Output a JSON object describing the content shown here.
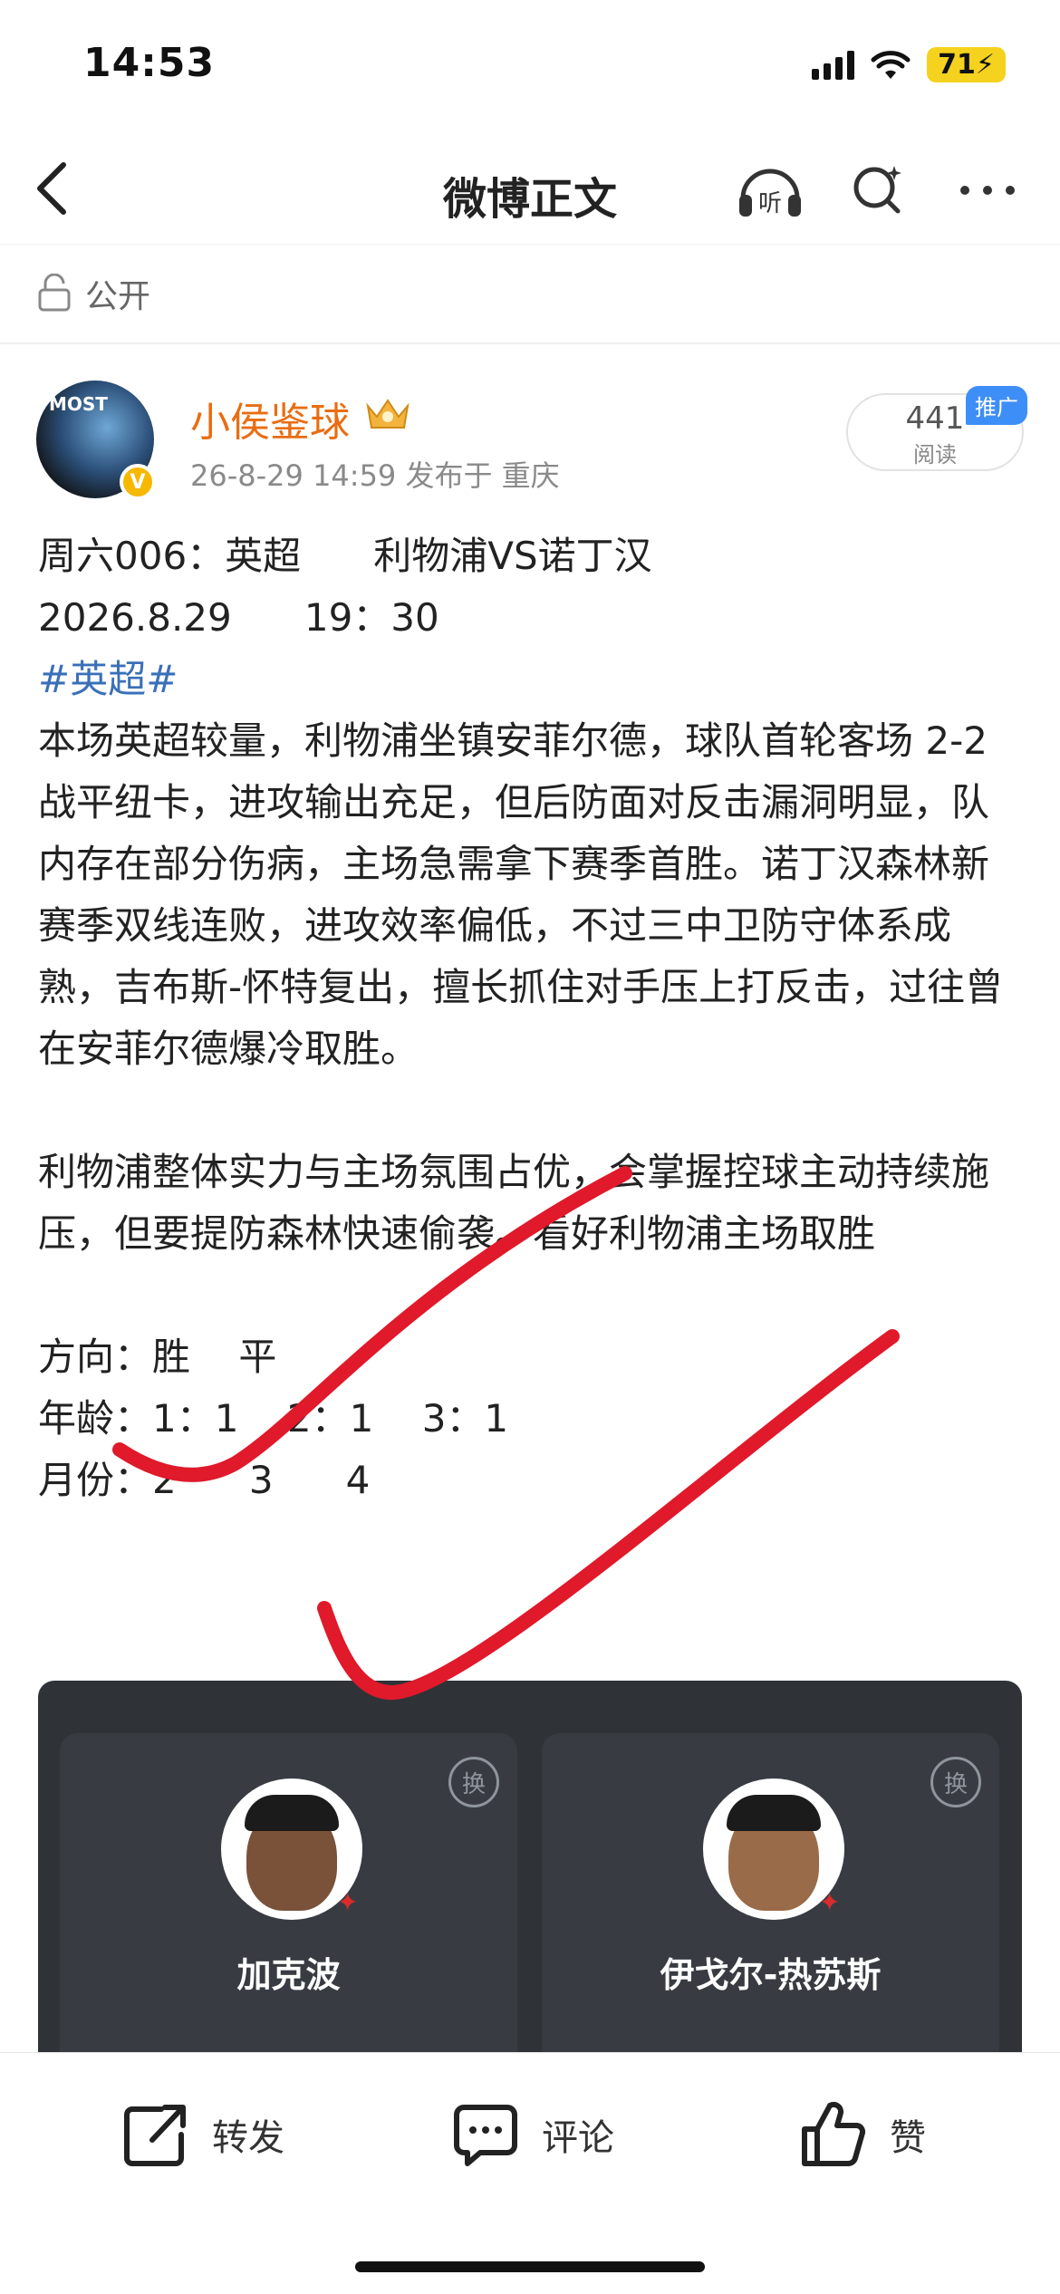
{
  "status_bar": {
    "time": "14:53",
    "battery": "71"
  },
  "nav": {
    "title": "微博正文"
  },
  "visibility": {
    "label": "公开"
  },
  "author": {
    "name": "小侯鉴球",
    "avatar_text": "MOST",
    "meta": "26-8-29 14:59  发布于 重庆",
    "reads_count": "441",
    "reads_label": "阅读",
    "promo_label": "推广"
  },
  "post": {
    "line1": "周六006：英超      利物浦VS诺丁汉",
    "line2": "2026.8.29      19：30",
    "hashtag": "#英超#",
    "paragraph1": "本场英超较量，利物浦坐镇安菲尔德，球队首轮客场 2-2 战平纽卡，进攻输出充足，但后防面对反击漏洞明显，队内存在部分伤病，主场急需拿下赛季首胜。诺丁汉森林新赛季双线连败，进攻效率偏低，不过三中卫防守体系成熟，吉布斯-怀特复出，擅长抓住对手压上打反击，过往曾在安菲尔德爆冷取胜。",
    "paragraph2": "利物浦整体实力与主场氛围占优，会掌握控球主动持续施压，但要提防森林快速偷袭。看好利物浦主场取胜",
    "direction": "方向：胜    平",
    "age": "年龄：1：1    2：1    3：1",
    "month": "月份：2      3      4"
  },
  "card": {
    "left_player": {
      "name": "加克波",
      "swap_label": "换"
    },
    "right_player": {
      "name": "伊戈尔-热苏斯",
      "swap_label": "换"
    }
  },
  "bottom_bar": {
    "share_label": "转发",
    "comment_label": "评论",
    "like_label": "赞"
  },
  "colors": {
    "accent_name": "#e96d12",
    "hashtag": "#3a70b8",
    "promo": "#3e8ef7",
    "battery": "#f5d21e",
    "card_bg": "#2f3338",
    "annotation_red": "#e0192b"
  }
}
